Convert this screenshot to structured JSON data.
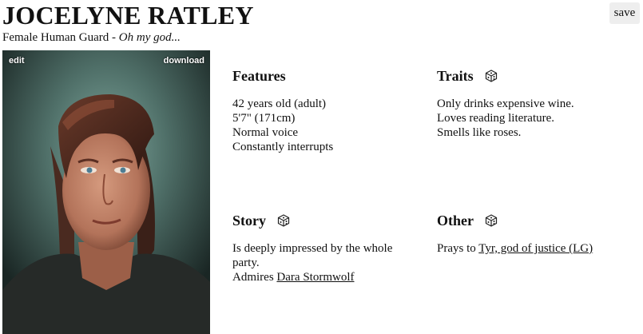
{
  "character": {
    "name": "JOCELYNE RATLEY",
    "descriptor": "Female Human Guard",
    "separator": " - ",
    "quote": "Oh my god..."
  },
  "toolbar": {
    "save_label": "save"
  },
  "portrait": {
    "edit_label": "edit",
    "download_label": "download"
  },
  "features": {
    "title": "Features",
    "items": [
      "42 years old (adult)",
      "5'7\" (171cm)",
      "Normal voice",
      "Constantly interrupts"
    ]
  },
  "traits": {
    "title": "Traits",
    "items": [
      "Only drinks expensive wine.",
      "Loves reading literature.",
      "Smells like roses."
    ]
  },
  "story": {
    "title": "Story",
    "line1": "Is deeply impressed by the whole party.",
    "admires_prefix": "Admires ",
    "admires_link": "Dara Stormwolf"
  },
  "other": {
    "title": "Other",
    "prays_prefix": "Prays to ",
    "prays_link": "Tyr, god of justice (LG)"
  },
  "icons": {
    "reroll": "dice-icon"
  }
}
